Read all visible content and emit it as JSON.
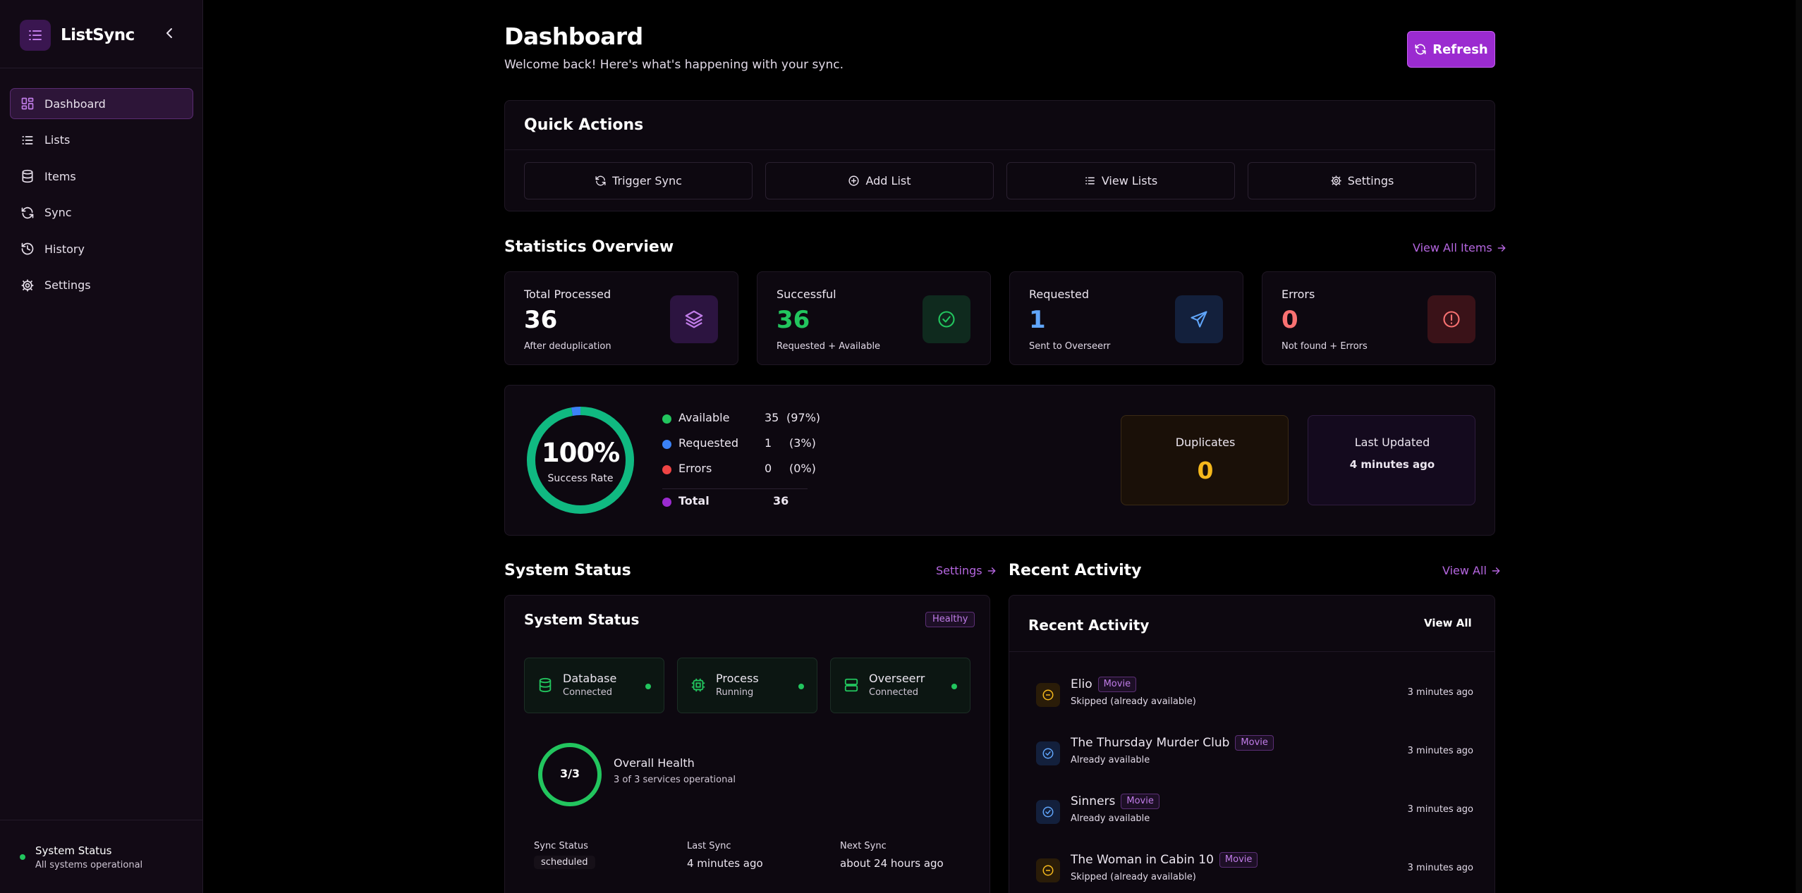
{
  "app": {
    "name": "ListSync"
  },
  "sidebar": {
    "items": [
      {
        "label": "Dashboard",
        "icon": "dashboard-icon",
        "active": true
      },
      {
        "label": "Lists",
        "icon": "list-icon"
      },
      {
        "label": "Items",
        "icon": "database-icon"
      },
      {
        "label": "Sync",
        "icon": "sync-icon"
      },
      {
        "label": "History",
        "icon": "history-icon"
      },
      {
        "label": "Settings",
        "icon": "gear-icon"
      }
    ],
    "footer": {
      "title": "System Status",
      "subtitle": "All systems operational"
    }
  },
  "header": {
    "title": "Dashboard",
    "subtitle": "Welcome back! Here's what's happening with your sync.",
    "refresh_label": "Refresh"
  },
  "quick_actions": {
    "title": "Quick Actions",
    "buttons": [
      {
        "label": "Trigger Sync",
        "icon": "sync-icon"
      },
      {
        "label": "Add List",
        "icon": "plus-circle-icon"
      },
      {
        "label": "View Lists",
        "icon": "list-icon"
      },
      {
        "label": "Settings",
        "icon": "gear-icon"
      }
    ]
  },
  "statistics": {
    "title": "Statistics Overview",
    "link": "View All Items",
    "cards": [
      {
        "label": "Total Processed",
        "value": "36",
        "desc": "After deduplication",
        "color": "#ffffff",
        "icon": "layers-icon"
      },
      {
        "label": "Successful",
        "value": "36",
        "desc": "Requested + Available",
        "color": "#22c55e",
        "icon": "check-circle-icon"
      },
      {
        "label": "Requested",
        "value": "1",
        "desc": "Sent to Overseerr",
        "color": "#60a5fa",
        "icon": "send-icon"
      },
      {
        "label": "Errors",
        "value": "0",
        "desc": "Not found + Errors",
        "color": "#f87171",
        "icon": "alert-circle-icon"
      }
    ]
  },
  "breakdown": {
    "success_rate": "100%",
    "success_label": "Success Rate",
    "chart_data": {
      "type": "pie",
      "categories": [
        "Available",
        "Requested",
        "Errors"
      ],
      "values": [
        35,
        1,
        0
      ],
      "colors": [
        "#10b981",
        "#3b82f6",
        "#ef4444"
      ]
    },
    "legend": [
      {
        "name": "Available",
        "value": "35",
        "pct": "(97%)",
        "color": "#22c55e"
      },
      {
        "name": "Requested",
        "value": "1",
        "pct": "(3%)",
        "color": "#3b82f6"
      },
      {
        "name": "Errors",
        "value": "0",
        "pct": "(0%)",
        "color": "#ef4444"
      }
    ],
    "total": {
      "name": "Total",
      "value": "36",
      "color": "#9b2bd0"
    },
    "duplicates": {
      "label": "Duplicates",
      "value": "0"
    },
    "last_updated": {
      "label": "Last Updated",
      "value": "4 minutes ago"
    }
  },
  "system_status": {
    "section_title": "System Status",
    "link": "Settings",
    "card_title": "System Status",
    "badge": "Healthy",
    "services": [
      {
        "name": "Database",
        "status": "Connected",
        "icon": "database-icon"
      },
      {
        "name": "Process",
        "status": "Running",
        "icon": "cpu-icon"
      },
      {
        "name": "Overseerr",
        "status": "Connected",
        "icon": "server-icon"
      }
    ],
    "health": {
      "value": "3/3",
      "title": "Overall Health",
      "subtitle": "3 of 3 services operational"
    },
    "sync": [
      {
        "key": "Sync Status",
        "value": "scheduled"
      },
      {
        "key": "Last Sync",
        "value": "4 minutes ago"
      },
      {
        "key": "Next Sync",
        "value": "about 24 hours ago"
      }
    ]
  },
  "recent_activity": {
    "section_title": "Recent Activity",
    "link": "View All",
    "card_title": "Recent Activity",
    "card_link": "View All",
    "items": [
      {
        "title": "Elio",
        "tag": "Movie",
        "status": "Skipped (already available)",
        "time": "3 minutes ago",
        "icon": "minus-circle-icon"
      },
      {
        "title": "The Thursday Murder Club",
        "tag": "Movie",
        "status": "Already available",
        "time": "3 minutes ago",
        "icon": "check-circle-icon"
      },
      {
        "title": "Sinners",
        "tag": "Movie",
        "status": "Already available",
        "time": "3 minutes ago",
        "icon": "check-circle-icon"
      },
      {
        "title": "The Woman in Cabin 10",
        "tag": "Movie",
        "status": "Skipped (already available)",
        "time": "3 minutes ago",
        "icon": "minus-circle-icon"
      }
    ]
  }
}
